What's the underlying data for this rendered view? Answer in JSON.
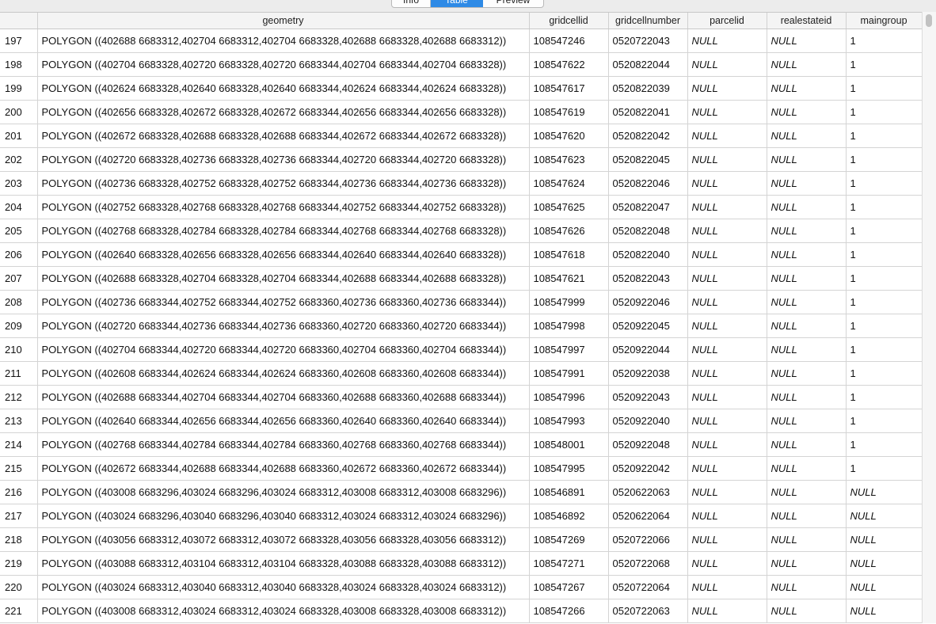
{
  "tabs": [
    "Info",
    "Table",
    "Preview"
  ],
  "columns": [
    "",
    "geometry",
    "gridcellid",
    "gridcellnumber",
    "parcelid",
    "realestateid",
    "maingroup"
  ],
  "rows": [
    [
      "197",
      "POLYGON ((402688 6683312,402704 6683312,402704 6683328,402688 6683328,402688 6683312))",
      "108547246",
      "0520722043",
      "NULL",
      "NULL",
      "1"
    ],
    [
      "198",
      "POLYGON ((402704 6683328,402720 6683328,402720 6683344,402704 6683344,402704 6683328))",
      "108547622",
      "0520822044",
      "NULL",
      "NULL",
      "1"
    ],
    [
      "199",
      "POLYGON ((402624 6683328,402640 6683328,402640 6683344,402624 6683344,402624 6683328))",
      "108547617",
      "0520822039",
      "NULL",
      "NULL",
      "1"
    ],
    [
      "200",
      "POLYGON ((402656 6683328,402672 6683328,402672 6683344,402656 6683344,402656 6683328))",
      "108547619",
      "0520822041",
      "NULL",
      "NULL",
      "1"
    ],
    [
      "201",
      "POLYGON ((402672 6683328,402688 6683328,402688 6683344,402672 6683344,402672 6683328))",
      "108547620",
      "0520822042",
      "NULL",
      "NULL",
      "1"
    ],
    [
      "202",
      "POLYGON ((402720 6683328,402736 6683328,402736 6683344,402720 6683344,402720 6683328))",
      "108547623",
      "0520822045",
      "NULL",
      "NULL",
      "1"
    ],
    [
      "203",
      "POLYGON ((402736 6683328,402752 6683328,402752 6683344,402736 6683344,402736 6683328))",
      "108547624",
      "0520822046",
      "NULL",
      "NULL",
      "1"
    ],
    [
      "204",
      "POLYGON ((402752 6683328,402768 6683328,402768 6683344,402752 6683344,402752 6683328))",
      "108547625",
      "0520822047",
      "NULL",
      "NULL",
      "1"
    ],
    [
      "205",
      "POLYGON ((402768 6683328,402784 6683328,402784 6683344,402768 6683344,402768 6683328))",
      "108547626",
      "0520822048",
      "NULL",
      "NULL",
      "1"
    ],
    [
      "206",
      "POLYGON ((402640 6683328,402656 6683328,402656 6683344,402640 6683344,402640 6683328))",
      "108547618",
      "0520822040",
      "NULL",
      "NULL",
      "1"
    ],
    [
      "207",
      "POLYGON ((402688 6683328,402704 6683328,402704 6683344,402688 6683344,402688 6683328))",
      "108547621",
      "0520822043",
      "NULL",
      "NULL",
      "1"
    ],
    [
      "208",
      "POLYGON ((402736 6683344,402752 6683344,402752 6683360,402736 6683360,402736 6683344))",
      "108547999",
      "0520922046",
      "NULL",
      "NULL",
      "1"
    ],
    [
      "209",
      "POLYGON ((402720 6683344,402736 6683344,402736 6683360,402720 6683360,402720 6683344))",
      "108547998",
      "0520922045",
      "NULL",
      "NULL",
      "1"
    ],
    [
      "210",
      "POLYGON ((402704 6683344,402720 6683344,402720 6683360,402704 6683360,402704 6683344))",
      "108547997",
      "0520922044",
      "NULL",
      "NULL",
      "1"
    ],
    [
      "211",
      "POLYGON ((402608 6683344,402624 6683344,402624 6683360,402608 6683360,402608 6683344))",
      "108547991",
      "0520922038",
      "NULL",
      "NULL",
      "1"
    ],
    [
      "212",
      "POLYGON ((402688 6683344,402704 6683344,402704 6683360,402688 6683360,402688 6683344))",
      "108547996",
      "0520922043",
      "NULL",
      "NULL",
      "1"
    ],
    [
      "213",
      "POLYGON ((402640 6683344,402656 6683344,402656 6683360,402640 6683360,402640 6683344))",
      "108547993",
      "0520922040",
      "NULL",
      "NULL",
      "1"
    ],
    [
      "214",
      "POLYGON ((402768 6683344,402784 6683344,402784 6683360,402768 6683360,402768 6683344))",
      "108548001",
      "0520922048",
      "NULL",
      "NULL",
      "1"
    ],
    [
      "215",
      "POLYGON ((402672 6683344,402688 6683344,402688 6683360,402672 6683360,402672 6683344))",
      "108547995",
      "0520922042",
      "NULL",
      "NULL",
      "1"
    ],
    [
      "216",
      "POLYGON ((403008 6683296,403024 6683296,403024 6683312,403008 6683312,403008 6683296))",
      "108546891",
      "0520622063",
      "NULL",
      "NULL",
      "NULL"
    ],
    [
      "217",
      "POLYGON ((403024 6683296,403040 6683296,403040 6683312,403024 6683312,403024 6683296))",
      "108546892",
      "0520622064",
      "NULL",
      "NULL",
      "NULL"
    ],
    [
      "218",
      "POLYGON ((403056 6683312,403072 6683312,403072 6683328,403056 6683328,403056 6683312))",
      "108547269",
      "0520722066",
      "NULL",
      "NULL",
      "NULL"
    ],
    [
      "219",
      "POLYGON ((403088 6683312,403104 6683312,403104 6683328,403088 6683328,403088 6683312))",
      "108547271",
      "0520722068",
      "NULL",
      "NULL",
      "NULL"
    ],
    [
      "220",
      "POLYGON ((403024 6683312,403040 6683312,403040 6683328,403024 6683328,403024 6683312))",
      "108547267",
      "0520722064",
      "NULL",
      "NULL",
      "NULL"
    ],
    [
      "221",
      "POLYGON ((403008 6683312,403024 6683312,403024 6683328,403008 6683328,403008 6683312))",
      "108547266",
      "0520722063",
      "NULL",
      "NULL",
      "NULL"
    ]
  ],
  "colors": {
    "accent": "#2e8ae6",
    "grid_line": "#d4d4d4",
    "header_bg": "#f4f4f4"
  }
}
